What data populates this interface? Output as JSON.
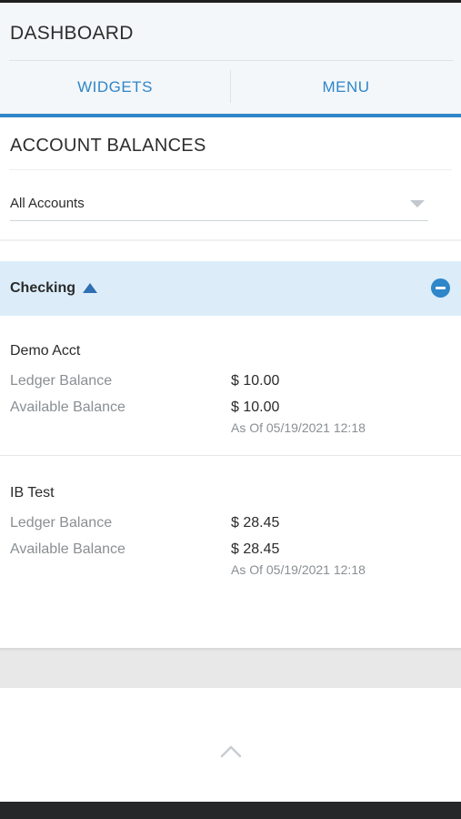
{
  "header": {
    "title": "DASHBOARD",
    "tabs": [
      {
        "label": "WIDGETS"
      },
      {
        "label": "MENU"
      }
    ]
  },
  "balances": {
    "title": "ACCOUNT BALANCES",
    "filter": {
      "selected": "All Accounts"
    },
    "groups": [
      {
        "label": "Checking",
        "expanded": true,
        "accounts": [
          {
            "name": "Demo Acct",
            "ledger_label": "Ledger Balance",
            "ledger_value": "$ 10.00",
            "available_label": "Available Balance",
            "available_value": "$ 10.00",
            "as_of": "As Of 05/19/2021 12:18"
          },
          {
            "name": "IB Test",
            "ledger_label": "Ledger Balance",
            "ledger_value": "$ 28.45",
            "available_label": "Available Balance",
            "available_value": "$ 28.45",
            "as_of": "As Of 05/19/2021 12:18"
          }
        ]
      }
    ]
  },
  "icons": {
    "group_toggle": "caret-up-icon",
    "collapse": "minus-circle-icon",
    "select_caret": "chevron-down-icon",
    "scroll_top": "chevron-up-icon"
  },
  "colors": {
    "accent": "#2f86c9",
    "group_bg": "#dcedf9",
    "header_bg": "#f4f7fa"
  }
}
